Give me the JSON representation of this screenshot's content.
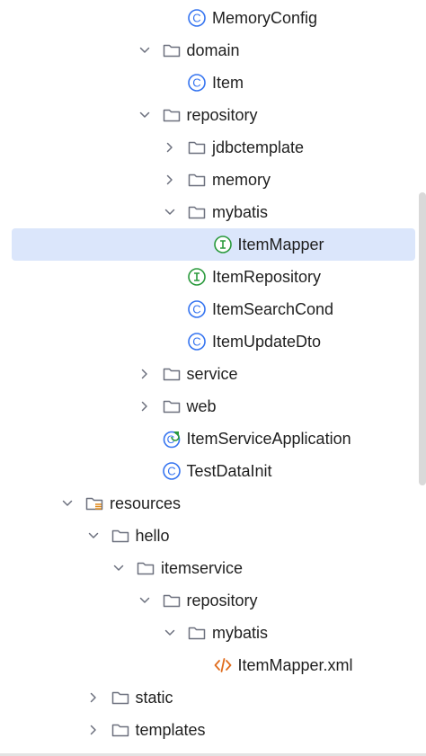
{
  "tree": {
    "rows": [
      {
        "label": "MemoryConfig",
        "icon": "class-icon",
        "chevron": "none",
        "level": 8
      },
      {
        "label": "domain",
        "icon": "folder-icon",
        "chevron": "expanded",
        "level": 7
      },
      {
        "label": "Item",
        "icon": "class-icon",
        "chevron": "none",
        "level": 8
      },
      {
        "label": "repository",
        "icon": "folder-icon",
        "chevron": "expanded",
        "level": 7
      },
      {
        "label": "jdbctemplate",
        "icon": "folder-icon",
        "chevron": "collapsed",
        "level": 8
      },
      {
        "label": "memory",
        "icon": "folder-icon",
        "chevron": "collapsed",
        "level": 8
      },
      {
        "label": "mybatis",
        "icon": "folder-icon",
        "chevron": "expanded",
        "level": 8
      },
      {
        "label": "ItemMapper",
        "icon": "interface-icon",
        "chevron": "none",
        "level": 9,
        "selected": true
      },
      {
        "label": "ItemRepository",
        "icon": "interface-icon",
        "chevron": "none",
        "level": 8
      },
      {
        "label": "ItemSearchCond",
        "icon": "class-icon",
        "chevron": "none",
        "level": 8
      },
      {
        "label": "ItemUpdateDto",
        "icon": "class-icon",
        "chevron": "none",
        "level": 8
      },
      {
        "label": "service",
        "icon": "folder-icon",
        "chevron": "collapsed",
        "level": 7
      },
      {
        "label": "web",
        "icon": "folder-icon",
        "chevron": "collapsed",
        "level": 7
      },
      {
        "label": "ItemServiceApplication",
        "icon": "spring-boot-class-icon",
        "chevron": "none",
        "level": 7
      },
      {
        "label": "TestDataInit",
        "icon": "class-icon",
        "chevron": "none",
        "level": 7
      },
      {
        "label": "resources",
        "icon": "resources-folder-icon",
        "chevron": "expanded",
        "level": 4
      },
      {
        "label": "hello",
        "icon": "folder-icon",
        "chevron": "expanded",
        "level": 5
      },
      {
        "label": "itemservice",
        "icon": "folder-icon",
        "chevron": "expanded",
        "level": 6
      },
      {
        "label": "repository",
        "icon": "folder-icon",
        "chevron": "expanded",
        "level": 7
      },
      {
        "label": "mybatis",
        "icon": "folder-icon",
        "chevron": "expanded",
        "level": 8
      },
      {
        "label": "ItemMapper.xml",
        "icon": "xml-file-icon",
        "chevron": "none",
        "level": 9
      },
      {
        "label": "static",
        "icon": "folder-icon",
        "chevron": "collapsed",
        "level": 5
      },
      {
        "label": "templates",
        "icon": "folder-icon",
        "chevron": "collapsed",
        "level": 5
      }
    ]
  },
  "colors": {
    "selection": "#dbe6fb",
    "class_icon": "#3574f0",
    "interface_icon": "#2a9a3c",
    "folder_icon": "#6c707e",
    "xml_icon": "#e06c1d",
    "resources_marker": "#e08a1d"
  }
}
